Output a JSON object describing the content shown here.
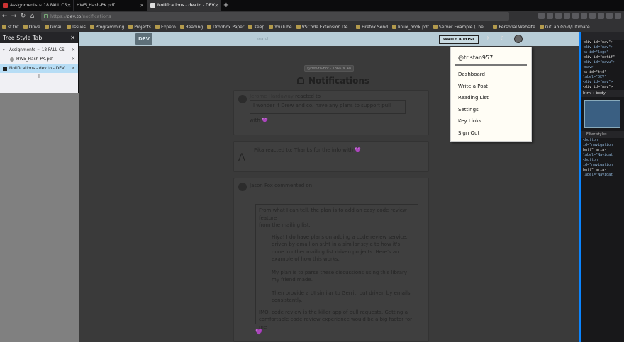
{
  "browser": {
    "tabs": [
      {
        "label": "Assignments ~ 18 FALL CS",
        "icon_color": "#c33"
      },
      {
        "label": "HW5_Hash-PK.pdf",
        "icon_color": "#888"
      },
      {
        "label": "Notifications - dev.to - DEV",
        "icon_color": "#222"
      }
    ],
    "url_prefix": "https://",
    "url_host": "dev.to",
    "url_path": "/notifications",
    "bookmarks": [
      "st.fnt",
      "Drive",
      "Gmail",
      "Issues",
      "Programming",
      "Projects",
      "Expero",
      "Reading",
      "Dropbox Paper",
      "Keep",
      "YouTube",
      "VSCode Extension De...",
      "Firefox Send",
      "linux_book.pdf",
      "Server Example (The ...",
      "Personal Website",
      "GitLab Gold/Ultimate"
    ]
  },
  "sidebar": {
    "title": "Tree Style Tab",
    "tabs": [
      {
        "label": "Assignments ~ 18 FALL CS",
        "child": false
      },
      {
        "label": "HW5_Hash-PK.pdf",
        "child": true
      },
      {
        "label": "Notifications - dev.to - DEV",
        "child": false
      }
    ],
    "add": "+"
  },
  "dev": {
    "logo": "DEV",
    "search_placeholder": "search",
    "write_label": "WRITE A POST",
    "banner": "@dev-to-bot · 1366 × 48",
    "title": "Notifications"
  },
  "notifications": [
    {
      "who": "Jerome Hardaway",
      "action": "reacted to",
      "quote": "I wonder if Drew and co. have any plans to support pull",
      "tail": "with 💜"
    },
    {
      "who": "Pika",
      "action": "reacted to: Thanks for the info",
      "quote": "",
      "tail": "with 💜"
    },
    {
      "who": "Jason Fox",
      "action": "commented on",
      "quote": "From what I can tell, the plan is to add an easy code review feature from the mailing list...",
      "tail": "💜"
    }
  ],
  "comment_body": [
    "From what I can tell, the plan is to add an easy code review feature",
    "from the mailing list.",
    "Hiya! I do have plans on adding a code review service,",
    "driven by email on sr.ht in a similar style to how it's",
    "done in other mailing list driven projects. Here's an",
    "example of how this works.",
    "My plan is to parse these discussions using this library",
    "my friend made.",
    "Then provide a UI similar to Gerrit, but driven by emails",
    "consistently.",
    "IMO, code review is the killer app of pull requests. Getting a",
    "comfortable code review experience would be a big factor for me"
  ],
  "dropdown": {
    "username": "@tristan957",
    "items": [
      "Dashboard",
      "Write a Post",
      "Reading List",
      "Settings",
      "Key Links",
      "Sign Out"
    ]
  },
  "devtools": {
    "crumb": "html › body",
    "filter": "Filter styles",
    "lines": [
      "<div id=\"nav\">",
      "<div id=\"nav\">",
      "<a id=\"logo\"",
      "<div id=\"notif\"",
      "<div id=\"navu\">",
      "<nav>",
      "<a id=\"ttd\"",
      "label=\"DEV\"",
      "<div id=\"nav\">",
      "<div id=\"nav\">",
      "<button",
      "id=\"navigation",
      "butt\" aria-",
      "label=\"Navigat"
    ]
  }
}
